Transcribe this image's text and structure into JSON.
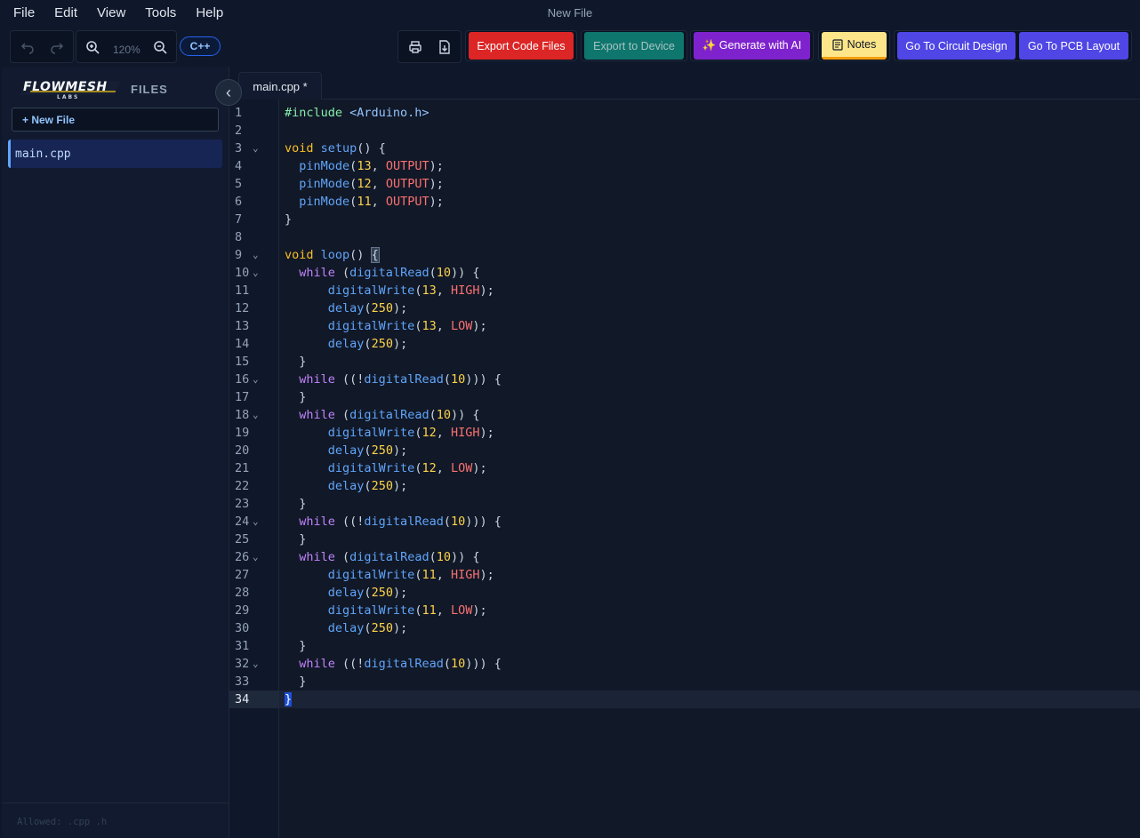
{
  "menu": {
    "items": [
      "File",
      "Edit",
      "View",
      "Tools",
      "Help"
    ],
    "window_title": "New File"
  },
  "toolbar": {
    "zoom_level": "120%",
    "language": "C++",
    "buttons": {
      "export_code": "Export Code Files",
      "export_device": "Export to Device",
      "generate_ai": "✨ Generate with AI",
      "notes": "Notes",
      "circuit": "Go To Circuit Design",
      "pcb": "Go To PCB Layout"
    }
  },
  "sidebar": {
    "brand_line1": "FLOWMESH",
    "brand_line2": "LABS",
    "files_label": "FILES",
    "new_file_label": "+ New File",
    "files": [
      "main.cpp"
    ],
    "allowed_text": "Allowed: .cpp .h"
  },
  "editor": {
    "tab_label": "main.cpp *",
    "active_line": 34,
    "folds": [
      3,
      9,
      10,
      16,
      18,
      24,
      26,
      32
    ],
    "lines": [
      "#include <Arduino.h>",
      "",
      "void setup() {",
      "  pinMode(13, OUTPUT);",
      "  pinMode(12, OUTPUT);",
      "  pinMode(11, OUTPUT);",
      "}",
      "",
      "void loop() {",
      "  while (digitalRead(10)) {",
      "      digitalWrite(13, HIGH);",
      "      delay(250);",
      "      digitalWrite(13, LOW);",
      "      delay(250);",
      "  }",
      "  while ((!digitalRead(10))) {",
      "  }",
      "  while (digitalRead(10)) {",
      "      digitalWrite(12, HIGH);",
      "      delay(250);",
      "      digitalWrite(12, LOW);",
      "      delay(250);",
      "  }",
      "  while ((!digitalRead(10))) {",
      "  }",
      "  while (digitalRead(10)) {",
      "      digitalWrite(11, HIGH);",
      "      delay(250);",
      "      digitalWrite(11, LOW);",
      "      delay(250);",
      "  }",
      "  while ((!digitalRead(10))) {",
      "  }",
      "}"
    ]
  },
  "colors": {
    "background": "#0f172a",
    "accent": "#4f46e5",
    "export": "#dc2626",
    "device": "#0f766e",
    "ai": "#7e22ce",
    "notes": "#fde68a"
  }
}
